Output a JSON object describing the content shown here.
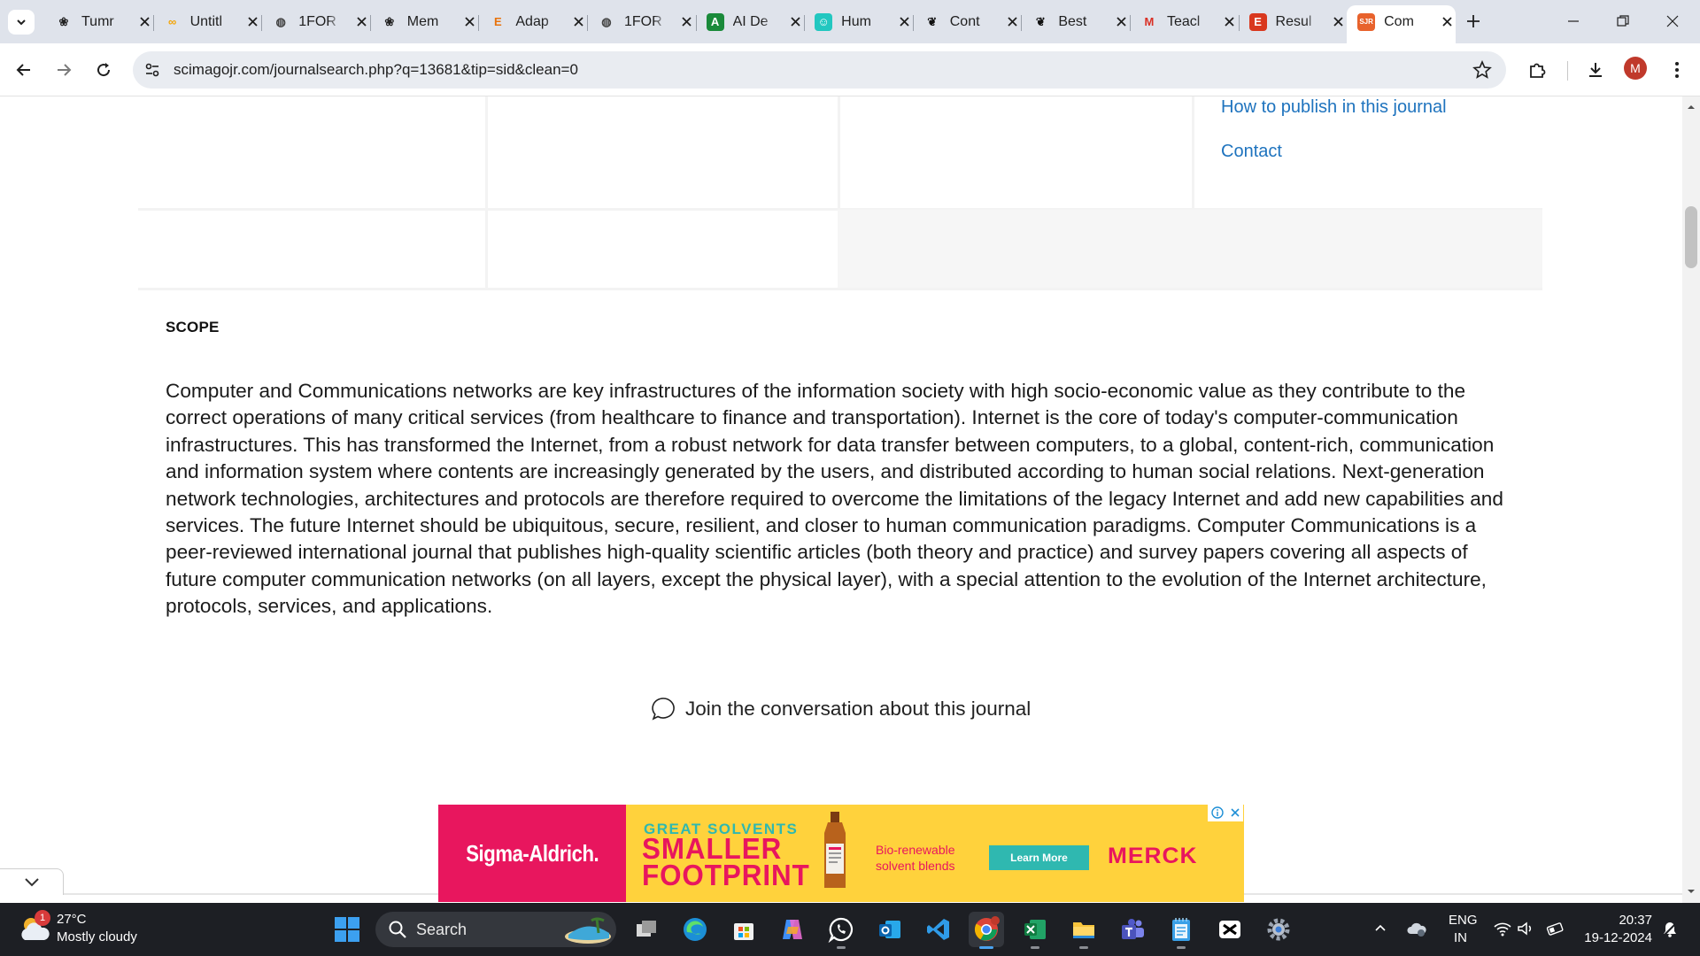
{
  "browser": {
    "tabs": [
      {
        "title": "Tumr",
        "icon": "openai-icon"
      },
      {
        "title": "Untitl",
        "icon": "colab-icon"
      },
      {
        "title": "1FOR",
        "icon": "globe-icon"
      },
      {
        "title": "Mem",
        "icon": "openai-icon"
      },
      {
        "title": "Adap",
        "icon": "e-icon"
      },
      {
        "title": "1FOR",
        "icon": "globe-icon"
      },
      {
        "title": "AI De",
        "icon": "ai-detector-icon"
      },
      {
        "title": "Hum",
        "icon": "humanizer-icon"
      },
      {
        "title": "Cont",
        "icon": "feather-icon"
      },
      {
        "title": "Best",
        "icon": "feather-icon"
      },
      {
        "title": "Teacl",
        "icon": "gmail-icon"
      },
      {
        "title": "Resul",
        "icon": "e-red-icon"
      },
      {
        "title": "Com",
        "icon": "sjr-icon",
        "active": true
      }
    ],
    "url": "scimagojr.com/journalsearch.php?q=13681&tip=sid&clean=0",
    "profile_initial": "M"
  },
  "page": {
    "side_links": [
      "How to publish in this journal",
      "Contact"
    ],
    "scope_title": "SCOPE",
    "scope_text": "Computer and Communications networks are key infrastructures of the information society with high socio-economic value as they contribute to the correct operations of many critical services (from healthcare to finance and transportation). Internet is the core of today's computer-communication infrastructures. This has transformed the Internet, from a robust network for data transfer between computers, to a global, content-rich, communication and information system where contents are increasingly generated by the users, and distributed according to human social relations. Next-generation network technologies, architectures and protocols are therefore required to overcome the limitations of the legacy Internet and add new capabilities and services. The future Internet should be ubiquitous, secure, resilient, and closer to human communication paradigms. Computer Communications is a peer-reviewed international journal that publishes high-quality scientific articles (both theory and practice) and survey papers covering all aspects of future computer communication networks (on all layers, except the physical layer), with a special attention to the evolution of the Internet architecture, protocols, services, and applications.",
    "join_label": "Join the conversation about this journal"
  },
  "ad": {
    "brand": "Sigma-Aldrich.",
    "headline_1": "GREAT SOLVENTS",
    "headline_2": "SMALLER",
    "headline_3": "FOOTPRINT",
    "subtext": "Bio-renewable solvent blends",
    "cta": "Learn More",
    "sponsor": "MERCK",
    "colors": {
      "pink": "#e8165e",
      "yellow": "#ffd23c",
      "teal": "#2fb8b0"
    }
  },
  "taskbar": {
    "weather_badge": "1",
    "weather_temp": "27°C",
    "weather_desc": "Mostly cloudy",
    "search_label": "Search",
    "lang_line1": "ENG",
    "lang_line2": "IN",
    "time": "20:37",
    "date": "19-12-2024"
  }
}
